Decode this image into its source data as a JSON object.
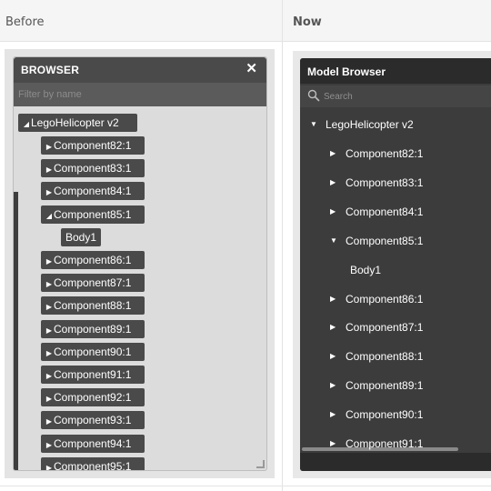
{
  "headers": {
    "before": "Before",
    "now": "Now"
  },
  "before": {
    "title": "BROWSER",
    "close_glyph": "✕",
    "filter_placeholder": "Filter by name",
    "root": "LegoHelicopter v2",
    "items": [
      {
        "label": "Component82:1",
        "expanded": false
      },
      {
        "label": "Component83:1",
        "expanded": false
      },
      {
        "label": "Component84:1",
        "expanded": false
      },
      {
        "label": "Component85:1",
        "expanded": true
      },
      {
        "label": "Body1",
        "leaf": true
      },
      {
        "label": "Component86:1",
        "expanded": false
      },
      {
        "label": "Component87:1",
        "expanded": false
      },
      {
        "label": "Component88:1",
        "expanded": false
      },
      {
        "label": "Component89:1",
        "expanded": false
      },
      {
        "label": "Component90:1",
        "expanded": false
      },
      {
        "label": "Component91:1",
        "expanded": false
      },
      {
        "label": "Component92:1",
        "expanded": false
      },
      {
        "label": "Component93:1",
        "expanded": false
      },
      {
        "label": "Component94:1",
        "expanded": false
      },
      {
        "label": "Component95:1",
        "expanded": false
      }
    ]
  },
  "now": {
    "title": "Model Browser",
    "search_placeholder": "Search",
    "root": "LegoHelicopter v2",
    "items": [
      {
        "label": "Component82:1",
        "expanded": false
      },
      {
        "label": "Component83:1",
        "expanded": false
      },
      {
        "label": "Component84:1",
        "expanded": false
      },
      {
        "label": "Component85:1",
        "expanded": true
      },
      {
        "label": "Body1",
        "leaf": true
      },
      {
        "label": "Component86:1",
        "expanded": false
      },
      {
        "label": "Component87:1",
        "expanded": false
      },
      {
        "label": "Component88:1",
        "expanded": false
      },
      {
        "label": "Component89:1",
        "expanded": false
      },
      {
        "label": "Component90:1",
        "expanded": false
      },
      {
        "label": "Component91:1",
        "expanded": false
      }
    ]
  },
  "icons": {
    "collapsed": "triangle-right-icon",
    "expanded": "triangle-down-icon",
    "close": "close-icon",
    "search": "search-icon"
  },
  "colors": {
    "old_panel_bg": "#dcdcdc",
    "old_node_bg": "#4a4a4a",
    "new_panel_bg": "#3c3c3c",
    "new_title_bg": "#2b2b2b"
  }
}
